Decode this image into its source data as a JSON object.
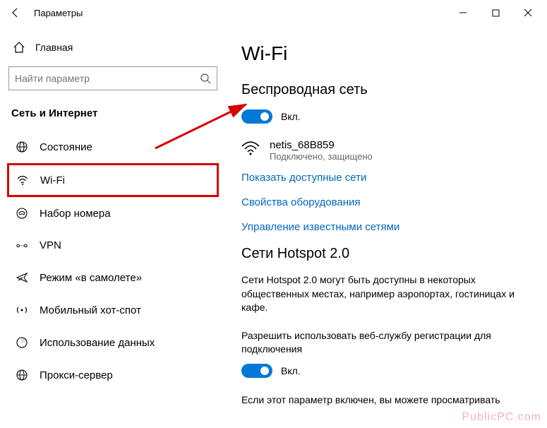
{
  "window": {
    "title": "Параметры"
  },
  "sidebar": {
    "home_label": "Главная",
    "search_placeholder": "Найти параметр",
    "section": "Сеть и Интернет",
    "items": [
      {
        "label": "Состояние",
        "icon": "globe-icon"
      },
      {
        "label": "Wi-Fi",
        "icon": "wifi-icon"
      },
      {
        "label": "Набор номера",
        "icon": "dialup-icon"
      },
      {
        "label": "VPN",
        "icon": "vpn-icon"
      },
      {
        "label": "Режим «в самолете»",
        "icon": "airplane-icon"
      },
      {
        "label": "Мобильный хот-спот",
        "icon": "hotspot-icon"
      },
      {
        "label": "Использование данных",
        "icon": "datausage-icon"
      },
      {
        "label": "Прокси-сервер",
        "icon": "proxy-icon"
      }
    ]
  },
  "main": {
    "page_title": "Wi-Fi",
    "wireless_heading": "Беспроводная сеть",
    "toggle1_label": "Вкл.",
    "network": {
      "ssid": "netis_68B859",
      "status": "Подключено, защищено"
    },
    "link_show_networks": "Показать доступные сети",
    "link_hw_properties": "Свойства оборудования",
    "link_manage_known": "Управление известными сетями",
    "hotspot_heading": "Сети Hotspot 2.0",
    "hotspot_desc": "Сети Hotspot 2.0 могут быть доступны в некоторых общественных местах, например аэропортах, гостиницах и кафе.",
    "hotspot_allow": "Разрешить использовать веб-службу регистрации для подключения",
    "toggle2_label": "Вкл.",
    "last_line": "Если этот параметр включен, вы можете просматривать"
  },
  "watermark": "PublicPC.com"
}
